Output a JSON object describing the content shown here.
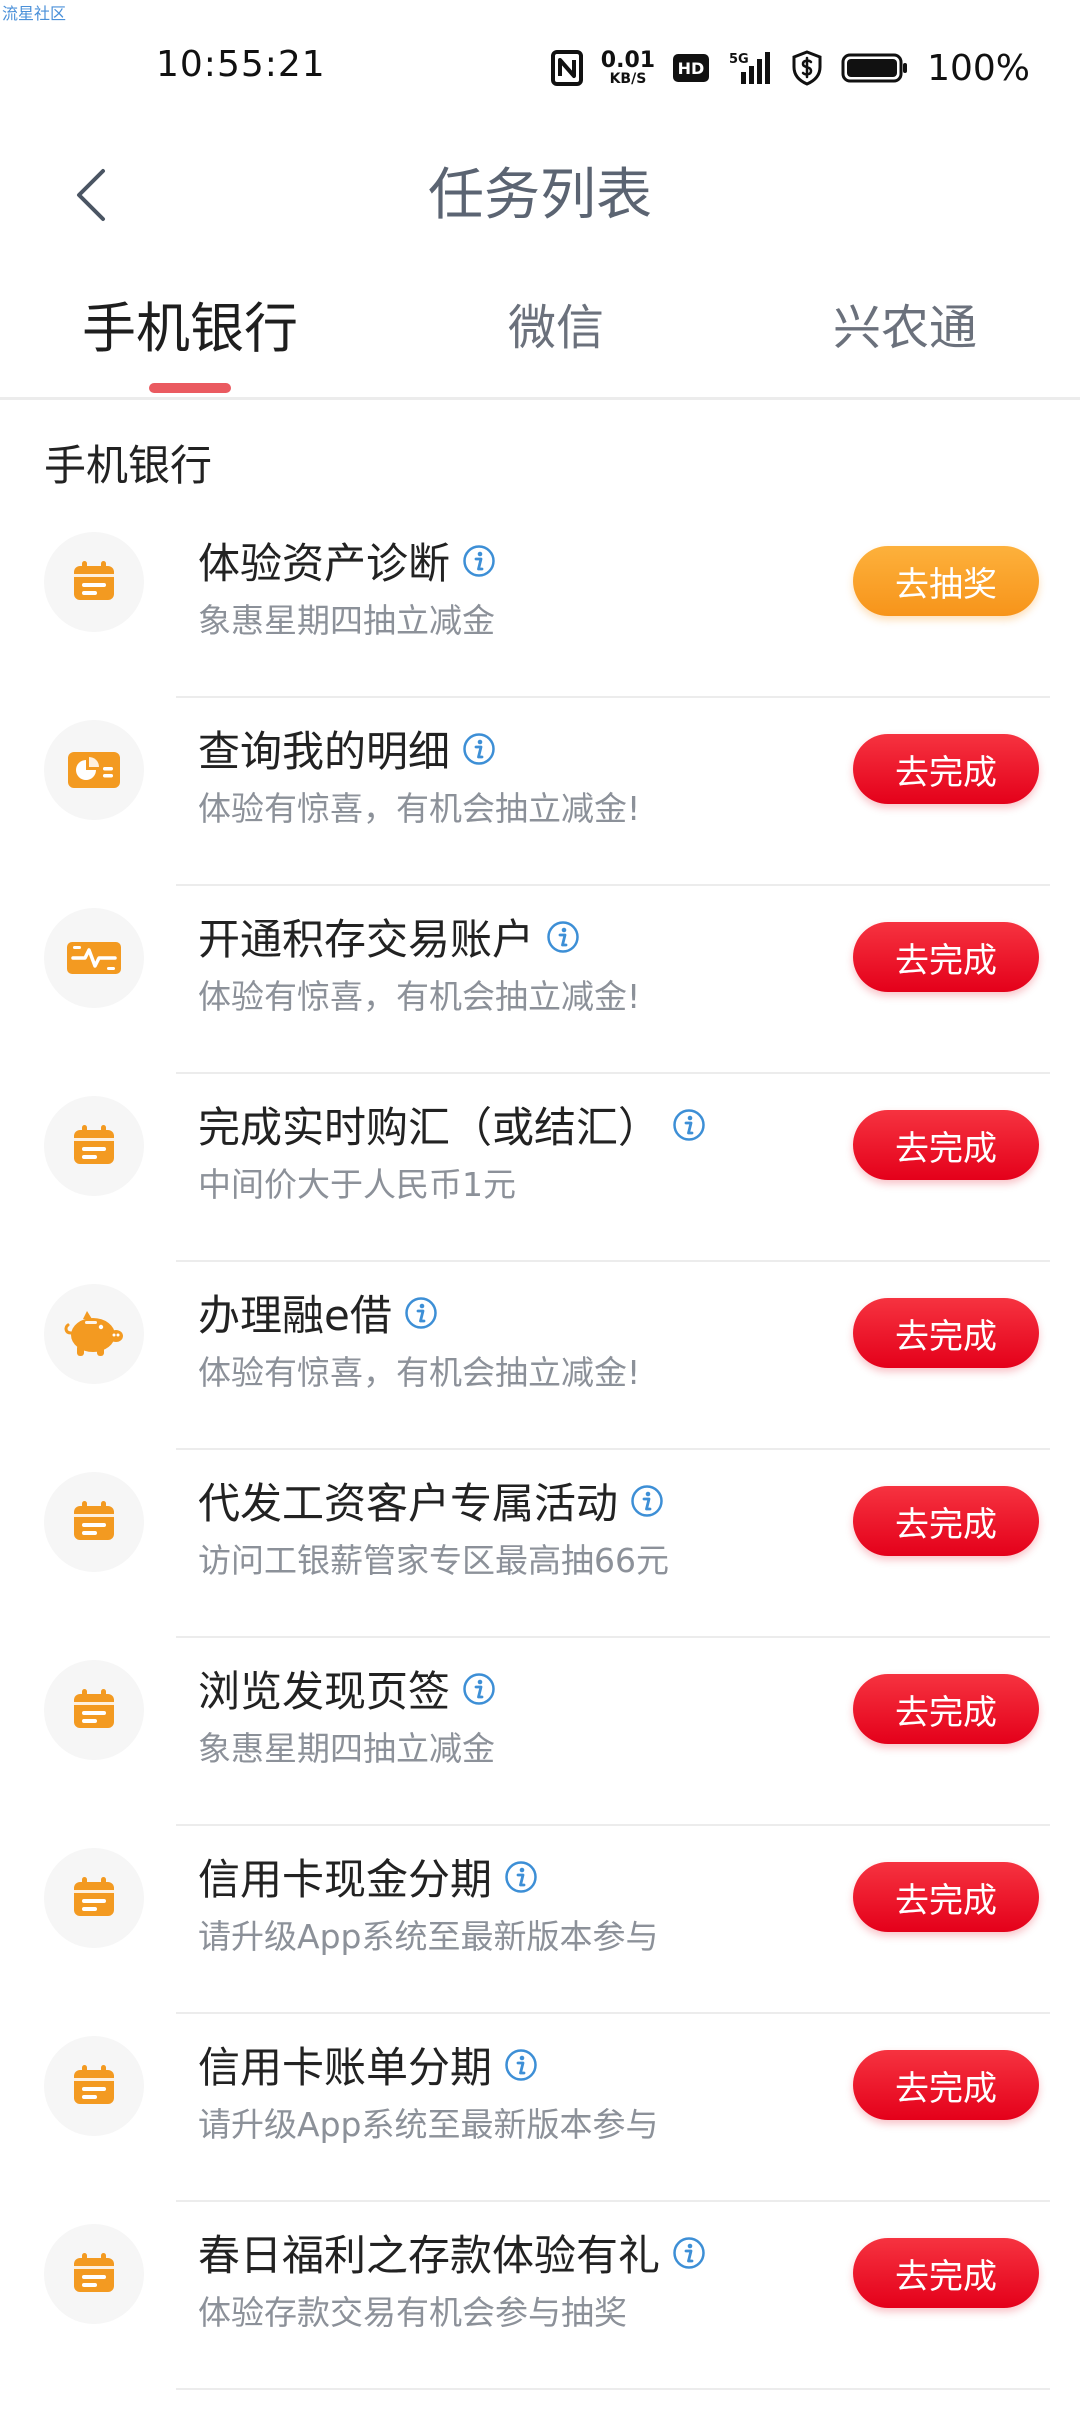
{
  "watermark": "流星社区",
  "status_bar": {
    "time": "10:55:21",
    "net_speed_value": "0.01",
    "net_speed_unit": "KB/S",
    "hd_label": "HD",
    "network_label": "5G",
    "battery": "100%",
    "icons": [
      "nfc-icon",
      "hd-icon",
      "signal-5g-icon",
      "shield-dollar-icon",
      "battery-icon"
    ]
  },
  "header": {
    "title": "任务列表"
  },
  "tabs": [
    {
      "label": "手机银行",
      "active": true
    },
    {
      "label": "微信",
      "active": false
    },
    {
      "label": "兴农通",
      "active": false
    }
  ],
  "section_title": "手机银行",
  "colors": {
    "accent_red": "#e4001a",
    "accent_orange": "#f7941a",
    "icon_orange": "#f39a21",
    "info_blue": "#3d8fd6",
    "tab_underline": "#ea5a60"
  },
  "tasks": [
    {
      "title": "体验资产诊断",
      "subtitle": "象惠星期四抽立减金",
      "button": "去抽奖",
      "button_style": "orange",
      "icon": "calendar-icon"
    },
    {
      "title": "查询我的明细",
      "subtitle": "体验有惊喜，有机会抽立减金!",
      "button": "去完成",
      "button_style": "red",
      "icon": "pie-card-icon"
    },
    {
      "title": "开通积存交易账户",
      "subtitle": "体验有惊喜，有机会抽立减金!",
      "button": "去完成",
      "button_style": "red",
      "icon": "gold-bar-icon"
    },
    {
      "title": "完成实时购汇（或结汇）",
      "subtitle": "中间价大于人民币1元",
      "button": "去完成",
      "button_style": "red",
      "icon": "calendar-icon"
    },
    {
      "title": "办理融e借",
      "subtitle": "体验有惊喜，有机会抽立减金!",
      "button": "去完成",
      "button_style": "red",
      "icon": "piggy-bank-icon"
    },
    {
      "title": "代发工资客户专属活动",
      "subtitle": "访问工银薪管家专区最高抽66元",
      "button": "去完成",
      "button_style": "red",
      "icon": "calendar-icon"
    },
    {
      "title": "浏览发现页签",
      "subtitle": "象惠星期四抽立减金",
      "button": "去完成",
      "button_style": "red",
      "icon": "calendar-icon"
    },
    {
      "title": "信用卡现金分期",
      "subtitle": "请升级App系统至最新版本参与",
      "button": "去完成",
      "button_style": "red",
      "icon": "calendar-icon"
    },
    {
      "title": "信用卡账单分期",
      "subtitle": "请升级App系统至最新版本参与",
      "button": "去完成",
      "button_style": "red",
      "icon": "calendar-icon"
    },
    {
      "title": "春日福利之存款体验有礼",
      "subtitle": "体验存款交易有机会参与抽奖",
      "button": "去完成",
      "button_style": "red",
      "icon": "calendar-icon"
    }
  ]
}
